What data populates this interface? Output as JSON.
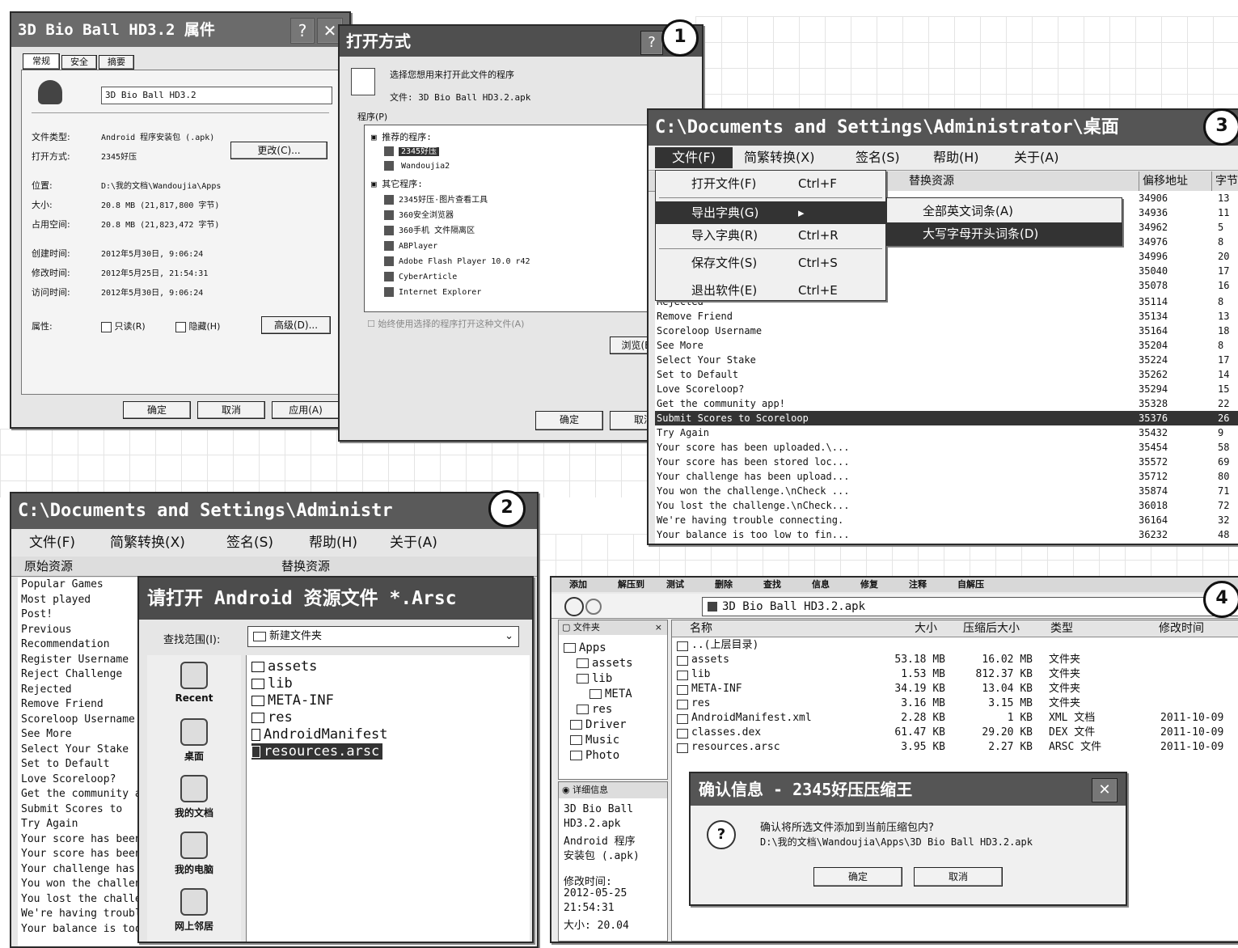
{
  "badges": [
    "1",
    "2",
    "3",
    "4"
  ],
  "w1": {
    "title": "3D Bio Ball HD3.2 属件",
    "help": "?",
    "close": "✕",
    "tabs": [
      "常规",
      "安全",
      "摘要"
    ],
    "filename": "3D Bio Ball HD3.2",
    "fields": [
      {
        "label": "文件类型:",
        "value": "Android 程序安装包 (.apk)"
      },
      {
        "label": "打开方式:",
        "value": "2345好压"
      },
      {
        "label": "位置:",
        "value": "D:\\我的文档\\Wandoujia\\Apps"
      },
      {
        "label": "大小:",
        "value": "20.8 MB (21,817,800 字节)"
      },
      {
        "label": "占用空间:",
        "value": "20.8 MB (21,823,472 字节)"
      },
      {
        "label": "创建时间:",
        "value": "2012年5月30日, 9:06:24"
      },
      {
        "label": "修改时间:",
        "value": "2012年5月25日, 21:54:31"
      },
      {
        "label": "访问时间:",
        "value": "2012年5月30日, 9:06:24"
      }
    ],
    "change_btn": "更改(C)...",
    "attr_label": "属性:",
    "readonly": "只读(R)",
    "hidden": "隐藏(H)",
    "advanced_btn": "高级(D)...",
    "ok": "确定",
    "cancel": "取消",
    "apply": "应用(A)"
  },
  "w2": {
    "title": "打开方式",
    "help": "?",
    "prompt": "选择您想用来打开此文件的程序",
    "file_line": "文件: 3D Bio Ball HD3.2.apk",
    "programs_label": "程序(P)",
    "recommended": "推荐的程序:",
    "rec_items": [
      "2345好压",
      "Wandoujia2"
    ],
    "other": "其它程序:",
    "other_items": [
      "2345好压·图片查看工具",
      "360安全浏览器",
      "360手机 文件隔离区",
      "ABPlayer",
      "Adobe Flash Player 10.0 r42",
      "CyberArticle",
      "Internet Explorer"
    ],
    "always": "始终使用选择的程序打开这种文件(A)",
    "browse": "浏览(B)...",
    "ok": "确定",
    "cancel": "取消"
  },
  "w3": {
    "title": "C:\\Documents and Settings\\Administrator\\桌面",
    "menus": [
      "文件(F)",
      "简繁转换(X)",
      "签名(S)",
      "帮助(H)",
      "关于(A)"
    ],
    "col_replace": "替换资源",
    "col_offset": "偏移地址",
    "col_len": "字节",
    "file_menu": [
      {
        "label": "打开文件(F)",
        "key": "Ctrl+F"
      },
      {
        "label": "导出字典(G)",
        "key": "▸"
      },
      {
        "label": "导入字典(R)",
        "key": "Ctrl+R"
      },
      {
        "label": "保存文件(S)",
        "key": "Ctrl+S"
      },
      {
        "label": "退出软件(E)",
        "key": "Ctrl+E"
      }
    ],
    "submenu": [
      "全部英文词条(A)",
      "大写字母开头词条(D)"
    ],
    "rows": [
      {
        "text": "Rejected",
        "offset": "35114",
        "len": "8"
      },
      {
        "text": "Remove Friend",
        "offset": "35134",
        "len": "13"
      },
      {
        "text": "Scoreloop Username",
        "offset": "35164",
        "len": "18"
      },
      {
        "text": "See More",
        "offset": "35204",
        "len": "8"
      },
      {
        "text": "Select Your Stake",
        "offset": "35224",
        "len": "17"
      },
      {
        "text": "Set to Default",
        "offset": "35262",
        "len": "14"
      },
      {
        "text": "Love Scoreloop?",
        "offset": "35294",
        "len": "15"
      },
      {
        "text": "Get the community app!",
        "offset": "35328",
        "len": "22"
      },
      {
        "text": "Submit Scores to Scoreloop",
        "offset": "35376",
        "len": "26"
      },
      {
        "text": "Try Again",
        "offset": "35432",
        "len": "9"
      },
      {
        "text": "Your score has been uploaded.\\...",
        "offset": "35454",
        "len": "58"
      },
      {
        "text": "Your score has been stored loc...",
        "offset": "35572",
        "len": "69"
      },
      {
        "text": "Your challenge has been upload...",
        "offset": "35712",
        "len": "80"
      },
      {
        "text": "You won the challenge.\\nCheck ...",
        "offset": "35874",
        "len": "71"
      },
      {
        "text": "You lost the challenge.\\nCheck...",
        "offset": "36018",
        "len": "72"
      },
      {
        "text": "We're having trouble connecting.",
        "offset": "36164",
        "len": "32"
      },
      {
        "text": "Your balance is too low to fin...",
        "offset": "36232",
        "len": "48"
      }
    ],
    "top_offsets": [
      {
        "offset": "34906",
        "len": "13"
      },
      {
        "offset": "34936",
        "len": "11"
      },
      {
        "offset": "34962",
        "len": "5"
      },
      {
        "offset": "34976",
        "len": "8"
      },
      {
        "offset": "34996",
        "len": "20"
      },
      {
        "offset": "35040",
        "len": "17"
      },
      {
        "offset": "35078",
        "len": "16"
      }
    ]
  },
  "w4": {
    "title": "C:\\Documents and Settings\\Administr",
    "menus": [
      "文件(F)",
      "简繁转换(X)",
      "签名(S)",
      "帮助(H)",
      "关于(A)"
    ],
    "col_orig": "原始资源",
    "col_replace": "替换资源",
    "rows": [
      "Popular Games",
      "Most played",
      "Post!",
      "Previous",
      "Recommendation",
      "Register Username",
      "Reject Challenge",
      "Rejected",
      "Remove Friend",
      "Scoreloop Username",
      "See More",
      "Select Your Stake",
      "Set to Default",
      "Love Scoreloop?",
      "Get the community app!",
      "Submit Scores to",
      "Try Again",
      "Your score has been",
      "Your score has been",
      "Your challenge has",
      "You won the challenge",
      "You lost the challenge",
      "We're having trouble",
      "Your balance is too"
    ]
  },
  "w5": {
    "title": "请打开 Android 资源文件 *.Arsc",
    "lookin_label": "查找范围(I):",
    "lookin_value": "新建文件夹",
    "places": [
      "Recent",
      "桌面",
      "我的文档",
      "我的电脑",
      "网上邻居"
    ],
    "files": [
      "assets",
      "lib",
      "META-INF",
      "res",
      "AndroidManifest",
      "resources.arsc"
    ]
  },
  "w6": {
    "toolbar": [
      "添加",
      "解压到",
      "测试",
      "删除",
      "查找",
      "信息",
      "修复",
      "注释",
      "自解压"
    ],
    "address": "3D Bio Ball HD3.2.apk",
    "tree_title": "文件夹",
    "tree": [
      "Apps",
      "assets",
      "lib",
      "META",
      "res",
      "Driver",
      "Music",
      "Photo"
    ],
    "details_title": "详细信息",
    "details": [
      "3D Bio Ball",
      "HD3.2.apk",
      "Android 程序",
      "安装包 (.apk)",
      "修改时间:",
      "2012-05-25",
      "21:54:31",
      "大小: 20.04"
    ],
    "cols": [
      "名称",
      "大小",
      "压缩后大小",
      "类型",
      "修改时间"
    ],
    "files": [
      {
        "name": "..(上层目录)",
        "size": "",
        "csize": "",
        "type": "",
        "date": ""
      },
      {
        "name": "assets",
        "size": "53.18 MB",
        "csize": "16.02 MB",
        "type": "文件夹",
        "date": ""
      },
      {
        "name": "lib",
        "size": "1.53 MB",
        "csize": "812.37 KB",
        "type": "文件夹",
        "date": ""
      },
      {
        "name": "META-INF",
        "size": "34.19 KB",
        "csize": "13.04 KB",
        "type": "文件夹",
        "date": ""
      },
      {
        "name": "res",
        "size": "3.16 MB",
        "csize": "3.15 MB",
        "type": "文件夹",
        "date": ""
      },
      {
        "name": "AndroidManifest.xml",
        "size": "2.28 KB",
        "csize": "1 KB",
        "type": "XML 文档",
        "date": "2011-10-09"
      },
      {
        "name": "classes.dex",
        "size": "61.47 KB",
        "csize": "29.20 KB",
        "type": "DEX 文件",
        "date": "2011-10-09"
      },
      {
        "name": "resources.arsc",
        "size": "3.95 KB",
        "csize": "2.27 KB",
        "type": "ARSC 文件",
        "date": "2011-10-09"
      }
    ]
  },
  "w7": {
    "title": "确认信息 - 2345好压压缩王",
    "line1": "确认将所选文件添加到当前压缩包内?",
    "line2": "D:\\我的文档\\Wandoujia\\Apps\\3D Bio Ball HD3.2.apk",
    "ok": "确定",
    "cancel": "取消"
  }
}
